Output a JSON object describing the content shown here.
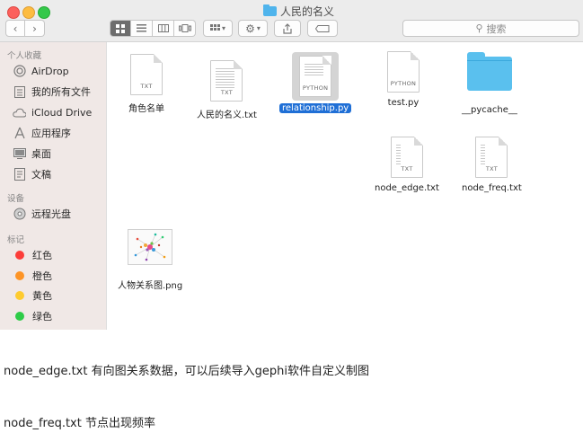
{
  "window": {
    "title": "人民的名义"
  },
  "toolbar": {
    "back_icon": "chevron-left-icon",
    "forward_icon": "chevron-right-icon",
    "search_placeholder": "搜索"
  },
  "sidebar": {
    "favorites_header": "个人收藏",
    "favorites": [
      {
        "label": "AirDrop",
        "icon": "airdrop-icon"
      },
      {
        "label": "我的所有文件",
        "icon": "all-files-icon"
      },
      {
        "label": "iCloud Drive",
        "icon": "cloud-icon"
      },
      {
        "label": "应用程序",
        "icon": "applications-icon"
      },
      {
        "label": "桌面",
        "icon": "desktop-icon"
      },
      {
        "label": "文稿",
        "icon": "documents-icon"
      }
    ],
    "devices_header": "设备",
    "devices": [
      {
        "label": "远程光盘",
        "icon": "disc-icon"
      }
    ],
    "tags_header": "标记",
    "tags": [
      {
        "label": "红色",
        "color": "#fc3d39"
      },
      {
        "label": "橙色",
        "color": "#fd9426"
      },
      {
        "label": "黄色",
        "color": "#fecb2f"
      },
      {
        "label": "绿色",
        "color": "#2ecc48"
      }
    ]
  },
  "files": [
    {
      "name": "角色名单",
      "type_label": "TXT"
    },
    {
      "name": "人民的名义.txt",
      "type_label": "TXT"
    },
    {
      "name": "relationship.py",
      "type_label": "PYTHON",
      "selected": true
    },
    {
      "name": "test.py",
      "type_label": "PYTHON"
    },
    {
      "name": "__pycache__",
      "type_label": ""
    },
    {
      "name": "node_edge.txt",
      "type_label": "TXT"
    },
    {
      "name": "node_freq.txt",
      "type_label": "TXT"
    },
    {
      "name": "人物关系图.png",
      "type_label": ""
    }
  ],
  "captions": {
    "line1": "node_edge.txt 有向图关系数据，可以后续导入gephi软件自定义制图",
    "line2": "node_freq.txt 节点出现频率"
  }
}
